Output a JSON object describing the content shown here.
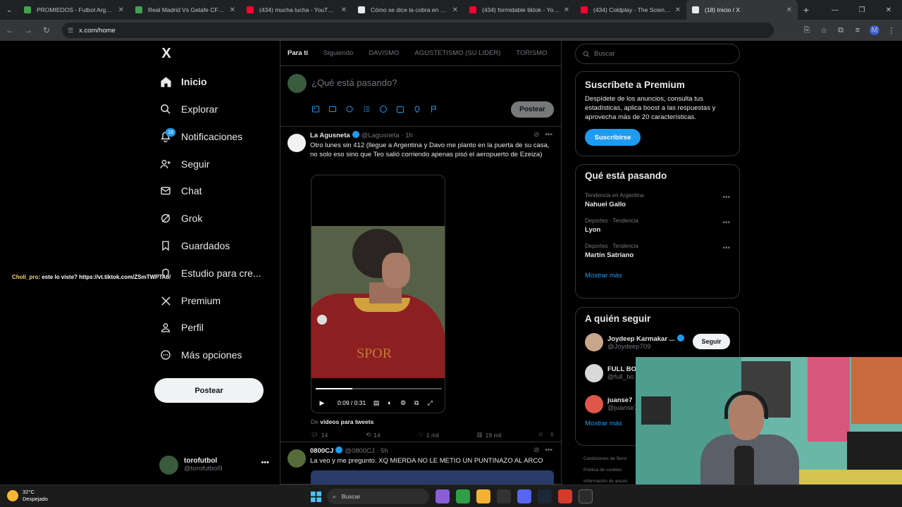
{
  "browser": {
    "tabs": [
      {
        "title": "PROMIEDOS - Futbol Argentino",
        "color": "#3fa34d",
        "active": false
      },
      {
        "title": "Real Madrid Vs Getafe CF - Res",
        "color": "#3fa34d",
        "active": false
      },
      {
        "title": "(434) mucha lucha - YouTube",
        "color": "#ff0033",
        "active": false
      },
      {
        "title": "Cómo se dice la cobra en difer",
        "color": "#e8eaed",
        "active": false
      },
      {
        "title": "(434) formidable tiktok - YouTu",
        "color": "#ff0033",
        "active": false
      },
      {
        "title": "(434) Coldplay - The Scientist (",
        "color": "#ff0033",
        "active": false
      },
      {
        "title": "(18) Inicio / X",
        "color": "#e8eaed",
        "active": true
      }
    ],
    "url": "x.com/home",
    "profile_initial": "M"
  },
  "nav": {
    "logo": "X",
    "items": [
      {
        "label": "Inicio",
        "icon": "home-icon"
      },
      {
        "label": "Explorar",
        "icon": "search-icon"
      },
      {
        "label": "Notificaciones",
        "icon": "bell-icon",
        "badge": "18"
      },
      {
        "label": "Seguir",
        "icon": "person-add-icon"
      },
      {
        "label": "Chat",
        "icon": "mail-icon"
      },
      {
        "label": "Grok",
        "icon": "grok-icon"
      },
      {
        "label": "Guardados",
        "icon": "bookmark-icon"
      },
      {
        "label": "Estudio para cre...",
        "icon": "studio-icon"
      },
      {
        "label": "Premium",
        "icon": "x-icon"
      },
      {
        "label": "Perfil",
        "icon": "profile-icon"
      },
      {
        "label": "Más opciones",
        "icon": "more-icon"
      }
    ],
    "post_button": "Postear",
    "user": {
      "name": "torofutbol",
      "handle": "@torofutbol9"
    }
  },
  "overlay": {
    "user": "Choli_pro",
    "text": ": este lo viste? https://vt.tiktok.com/ZSmTWPTA6/"
  },
  "feed": {
    "tabs": [
      "Para ti",
      "Siguiendo",
      "DAVISMO",
      "AGUSTETISMO (SU LIDER)",
      "TORISMO"
    ],
    "composer_placeholder": "¿Qué está pasando?",
    "post_button": "Postear",
    "tweets": [
      {
        "name": "La Agusneta",
        "handle": "@Lagusneta",
        "time": "· 1h",
        "text": "Otro lunes sin 412 (llegue a Argentina y Davo me planto en la puerta de su casa, no solo eso sino que Teo salió corriendo apenas pisó el aeropuerto de Ezeiza)",
        "video": {
          "time": "0:09 / 0:31",
          "progress": 0.29,
          "shirt_text": "SPOR"
        },
        "from_prefix": "De",
        "from_source": "videos para tweets",
        "stats": {
          "replies": "14",
          "reposts": "14",
          "likes": "1 mil",
          "views": "19 mil"
        }
      },
      {
        "name": "0800CJ",
        "handle": "@0800CJ",
        "time": "· 5h",
        "text": "La veo y me pregunto. XQ MIERDA NO LE METIO UN PUNTINAZO AL ARCO"
      }
    ]
  },
  "sidebar": {
    "search_placeholder": "Buscar",
    "premium": {
      "title": "Suscríbete a Premium",
      "text": "Despídete de los anuncios, consulta tus estadísticas, aplica boost a las respuestas y aprovecha más de 20 características.",
      "button": "Suscribirse"
    },
    "trends_title": "Qué está pasando",
    "trends": [
      {
        "meta": "Tendencia en Argentina",
        "name": "Nahuel Gallo"
      },
      {
        "meta": "Deportes · Tendencia",
        "name": "Lyon"
      },
      {
        "meta": "Deportes · Tendencia",
        "name": "Martín Satriano"
      }
    ],
    "show_more": "Mostrar más",
    "follow_title": "A quién seguir",
    "follow": [
      {
        "name": "Joydeep Karmakar ...",
        "handle": "@Joydeep709",
        "button": "Seguir"
      },
      {
        "name": "FULL BO",
        "handle": "@full_bo"
      },
      {
        "name": "juanse7",
        "handle": "@juanse7"
      }
    ],
    "footer": [
      "Condiciones de Servi",
      "Política de cookies",
      "Información de anunc"
    ]
  },
  "taskbar": {
    "temp": "32°C",
    "weather": "Despejado",
    "search": "Buscar"
  }
}
